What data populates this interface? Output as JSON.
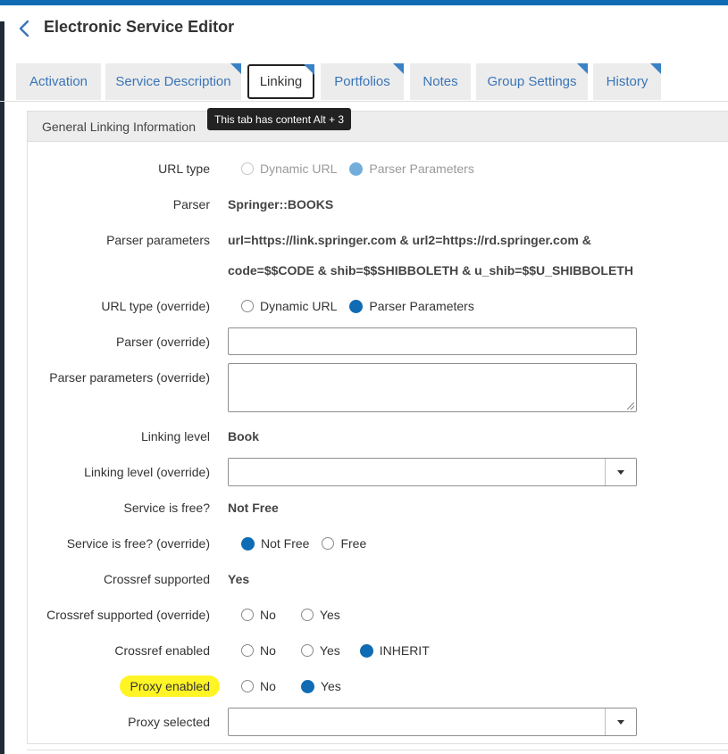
{
  "header": {
    "title": "Electronic Service Editor"
  },
  "tabs": [
    {
      "label": "Activation",
      "has_content": false
    },
    {
      "label": "Service Description",
      "has_content": true
    },
    {
      "label": "Linking",
      "has_content": true,
      "active": true
    },
    {
      "label": "Portfolios",
      "has_content": true
    },
    {
      "label": "Notes",
      "has_content": false
    },
    {
      "label": "Group Settings",
      "has_content": true
    },
    {
      "label": "History",
      "has_content": true
    }
  ],
  "tooltip": "This tab has content Alt + 3",
  "section": {
    "title": "General Linking Information"
  },
  "fields": {
    "url_type": {
      "label": "URL type",
      "options": [
        "Dynamic URL",
        "Parser Parameters"
      ],
      "selected": "Parser Parameters"
    },
    "parser": {
      "label": "Parser",
      "value": "Springer::BOOKS"
    },
    "parser_parameters": {
      "label": "Parser parameters",
      "line1": "url=https://link.springer.com & url2=https://rd.springer.com &",
      "line2": "code=$$CODE & shib=$$SHIBBOLETH & u_shib=$$U_SHIBBOLETH"
    },
    "url_type_override": {
      "label": "URL type (override)",
      "options": [
        "Dynamic URL",
        "Parser Parameters"
      ],
      "selected": "Parser Parameters"
    },
    "parser_override": {
      "label": "Parser (override)",
      "value": ""
    },
    "parser_parameters_override": {
      "label": "Parser parameters (override)",
      "value": ""
    },
    "linking_level": {
      "label": "Linking level",
      "value": "Book"
    },
    "linking_level_override": {
      "label": "Linking level (override)",
      "value": ""
    },
    "service_free": {
      "label": "Service is free?",
      "value": "Not Free"
    },
    "service_free_override": {
      "label": "Service is free? (override)",
      "options": [
        "Not Free",
        "Free"
      ],
      "selected": "Not Free"
    },
    "crossref_supported": {
      "label": "Crossref supported",
      "value": "Yes"
    },
    "crossref_supported_override": {
      "label": "Crossref supported (override)",
      "options": [
        "No",
        "Yes"
      ],
      "selected": ""
    },
    "crossref_enabled": {
      "label": "Crossref enabled",
      "options": [
        "No",
        "Yes",
        "INHERIT"
      ],
      "selected": "INHERIT"
    },
    "proxy_enabled": {
      "label": "Proxy enabled",
      "options": [
        "No",
        "Yes"
      ],
      "selected": "Yes"
    },
    "proxy_selected": {
      "label": "Proxy selected",
      "value": ""
    }
  },
  "colors": {
    "accent": "#0f6bb3",
    "tab_link": "#3a75b7",
    "highlight": "#fff200"
  }
}
